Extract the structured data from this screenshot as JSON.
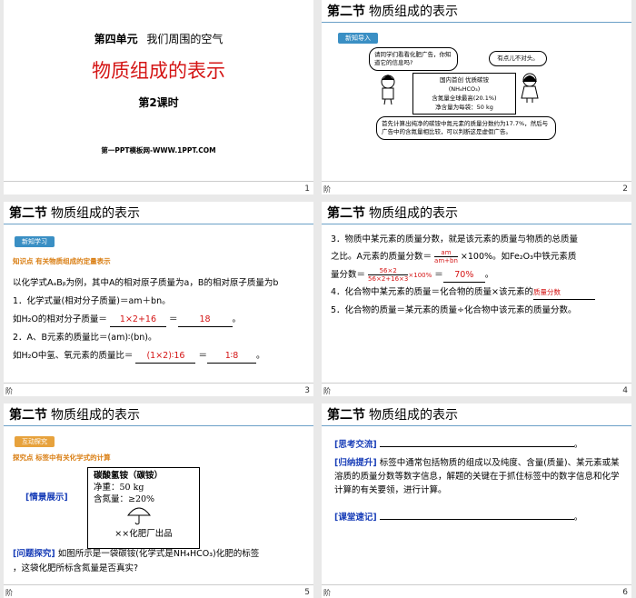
{
  "slide1": {
    "unit": "第四单元",
    "unit_title": "我们周围的空气",
    "title": "物质组成的表示",
    "lesson": "第2课时",
    "website": "第一PPT模板网-WWW.1PPT.COM",
    "page": "1"
  },
  "slide2": {
    "section": "第二节",
    "section_title": "物质组成的表示",
    "tag": "新知导入",
    "bubble1": "请同学们看看化肥广告，你知道它的信息吗?",
    "bubble2": "有点儿不对头。",
    "ad_line1": "国内首创  优质碳铵",
    "ad_line2": "(NH₄HCO₃)",
    "ad_line3": "含氮量全球最高(20.1%)",
    "ad_line4": "净含量为每袋：50 kg",
    "bubble3": "首先计算出纯净的碳铵中氮元素的质量分数约为17.7%，然后与广告中的含氮量相比较，可以判断这是虚假广告。",
    "page": "2"
  },
  "slide3": {
    "section": "第二节",
    "section_title": "物质组成的表示",
    "tag": "新知学习",
    "point": "知识点  有关物质组成的定量表示",
    "line1": "以化学式AₐBᵦ为例，其中A的相对原子质量为a，B的相对原子质量为b",
    "line2": "1．化学式量(相对分子质量)＝am＋bn。",
    "line3_pre": "如H₂O的相对分子质量＝",
    "line3_ans": "1×2+16",
    "line3_ans2": "18",
    "line4": "2．A、B元素的质量比＝(am)∶(bn)。",
    "line5_pre": "如H₂O中氢、氧元素的质量比＝",
    "line5_ans": "(1×2)∶16",
    "line5_ans2": "1∶8",
    "page": "3"
  },
  "slide4": {
    "section": "第二节",
    "section_title": "物质组成的表示",
    "line1": "3．物质中某元素的质量分数，就是该元素的质量与物质的总质量",
    "line2_pre": "之比。A元素的质量分数＝",
    "frac1_num": "am",
    "frac1_den": "am+bn",
    "line2_post": "×100%。如Fe₂O₃中铁元素质",
    "line3_pre": "量分数＝",
    "frac2_num": "56×2",
    "frac2_den": "56×2+16×3",
    "frac2_tail": "×100%",
    "line3_ans": "70%",
    "line4_pre": "4．化合物中某元素的质量＝化合物的质量×该元素的",
    "line4_ans": "质量分数",
    "line5": "5．化合物的质量＝某元素的质量÷化合物中该元素的质量分数。",
    "page": "4"
  },
  "slide5": {
    "section": "第二节",
    "section_title": "物质组成的表示",
    "tag": "互动探究",
    "point": "探究点  标签中有关化学式的计算",
    "situation_label": "[情景展示]",
    "label_line1": "碳酸氢铵（碳铵）",
    "label_line2": "净重：50 kg",
    "label_line3": "含氮量：≥20%",
    "label_line4": "××化肥厂出品",
    "question_label": "[问题探究]",
    "question_text": "如图所示是一袋碳铵(化学式是NH₄HCO₃)化肥的标签",
    "question_text2": "，这袋化肥所标含氮量是否真实?",
    "page": "5"
  },
  "slide6": {
    "section": "第二节",
    "section_title": "物质组成的表示",
    "think_label": "[思考交流]",
    "summary_label": "[归纳提升]",
    "summary_text": "标签中通常包括物质的组成以及纯度、含量(质量)、某元素或某溶质的质量分数等数字信息，解题的关键在于抓住标签中的数字信息和化学计算的有关要领，进行计算。",
    "notes_label": "[课堂速记]",
    "page": "6"
  },
  "footer_label": "阶"
}
